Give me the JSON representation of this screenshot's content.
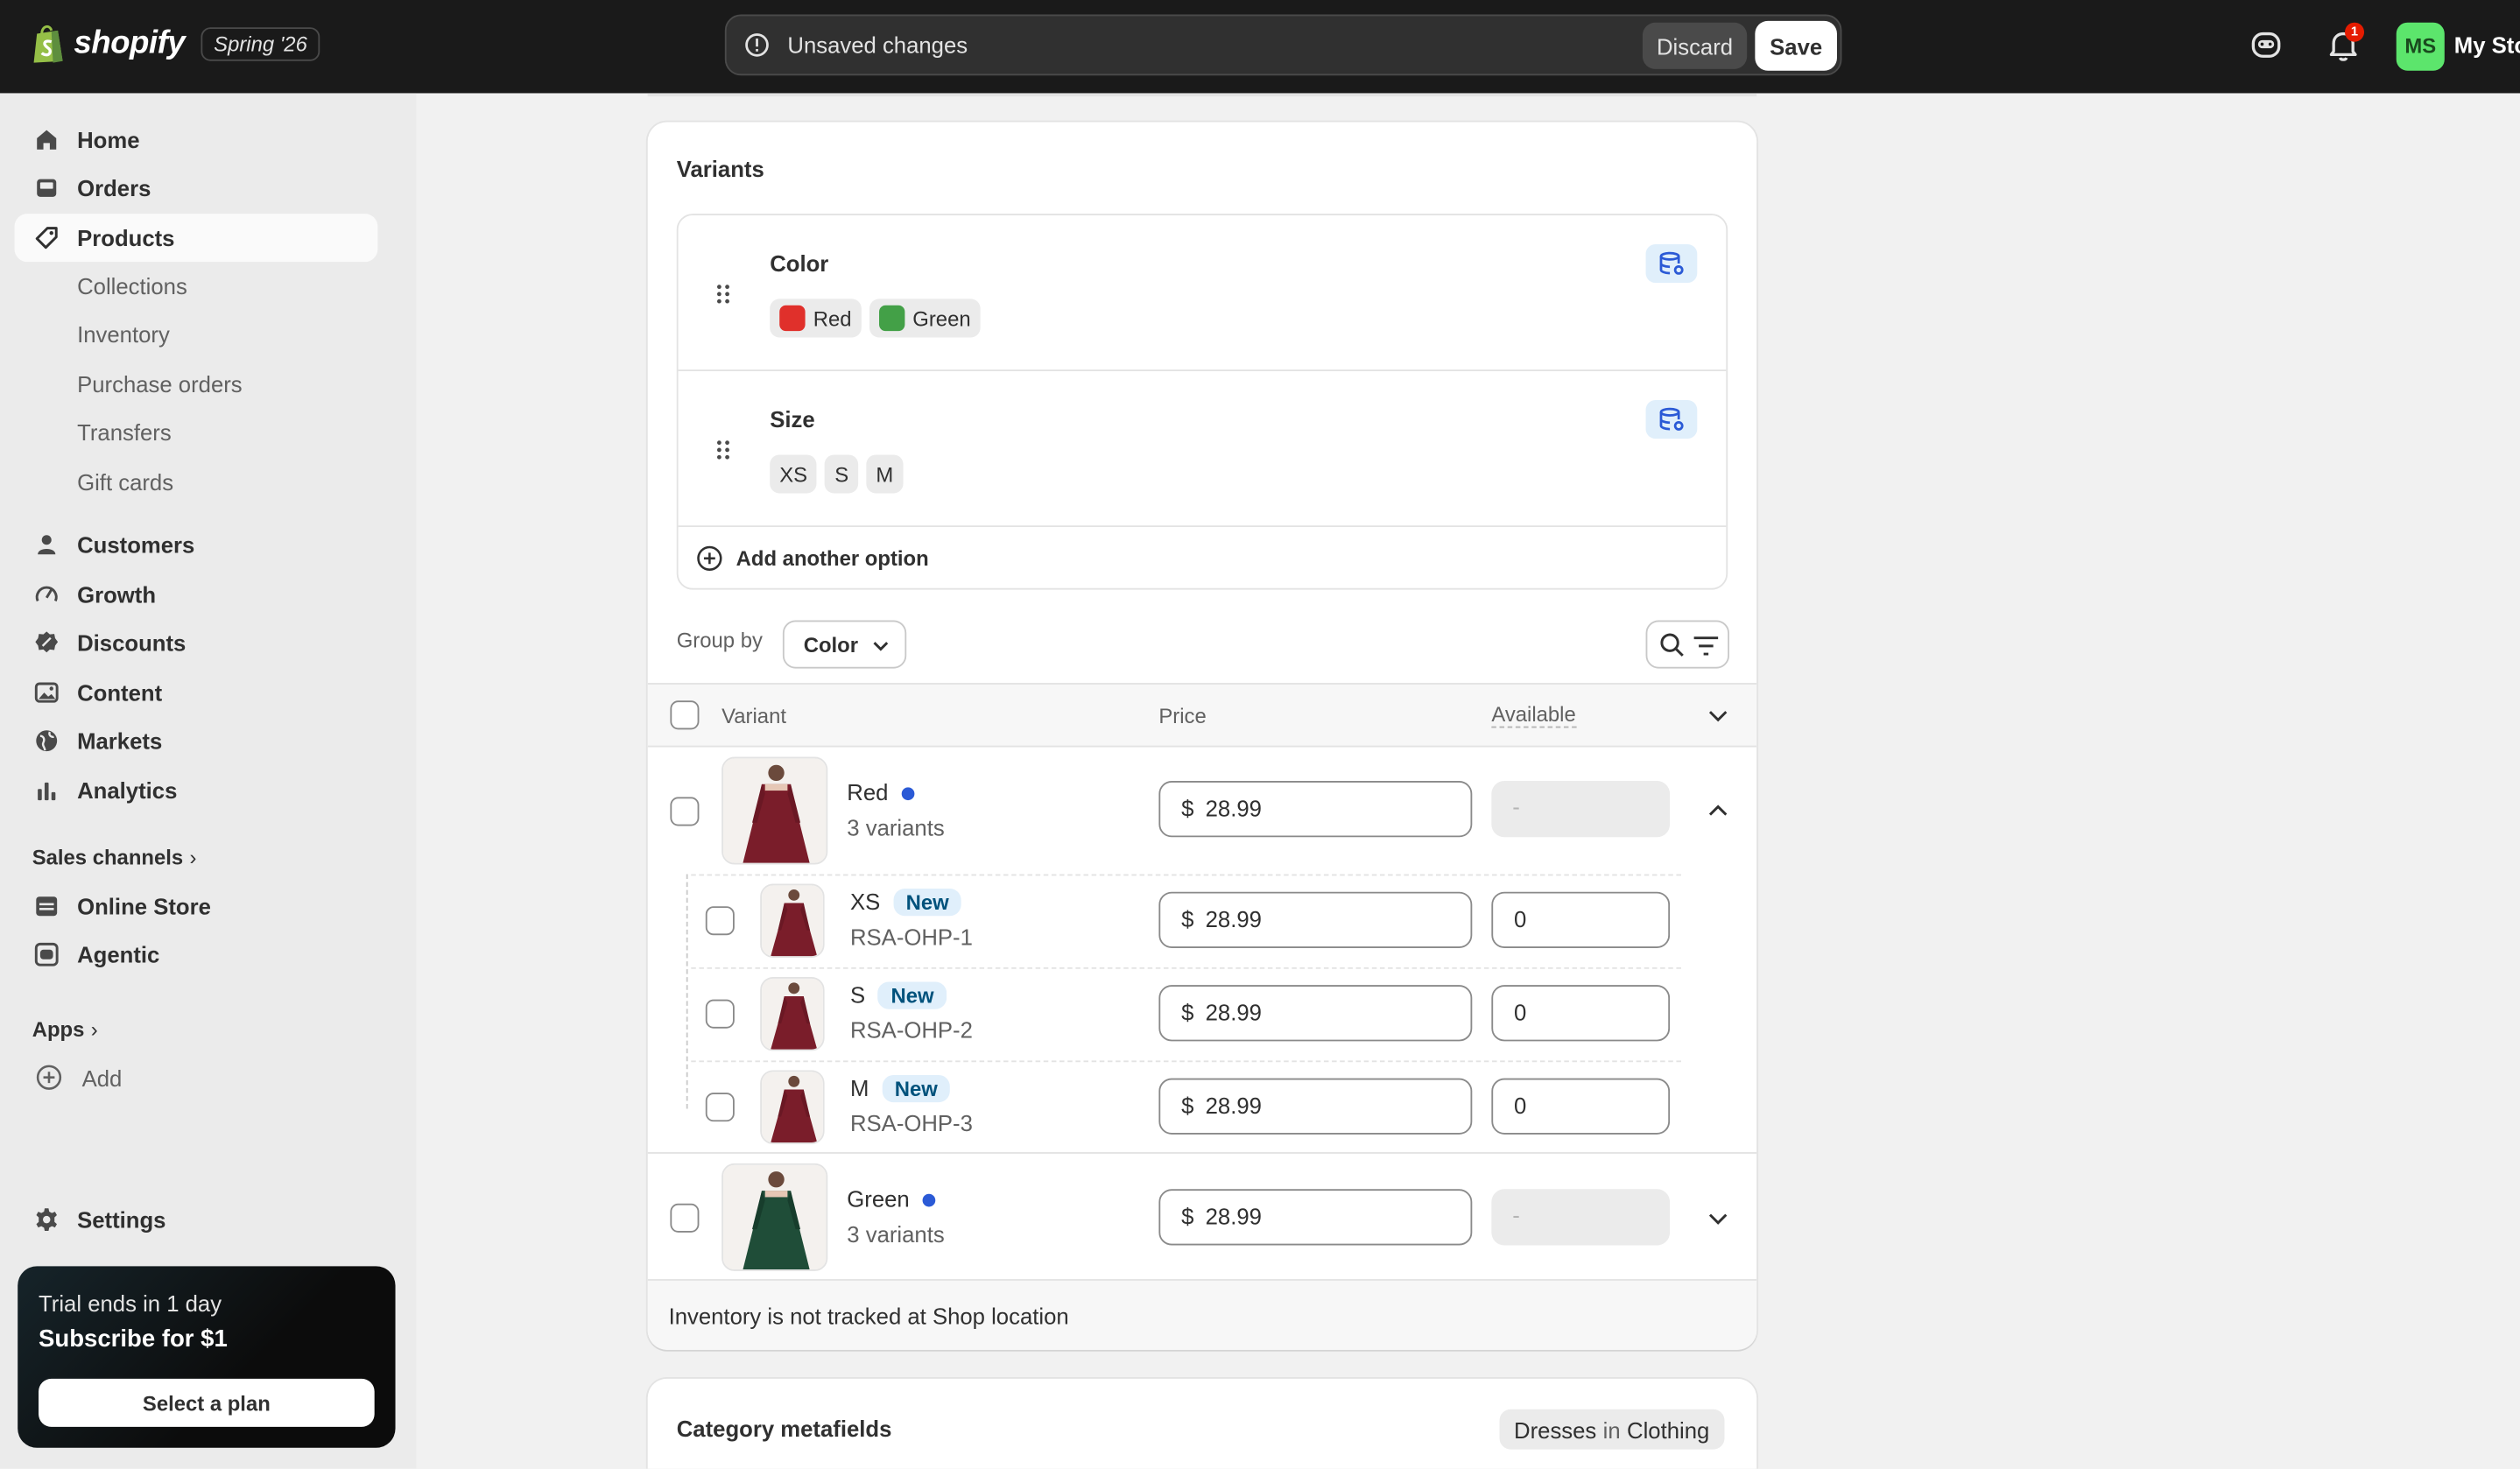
{
  "topbar": {
    "brand": "shopify",
    "edition": "Spring '26",
    "unsaved_message": "Unsaved changes",
    "discard_label": "Discard",
    "save_label": "Save",
    "notification_count": "1",
    "avatar_initials": "MS",
    "store_name": "My Sto"
  },
  "sidebar": {
    "items": [
      {
        "label": "Home",
        "icon": "home-icon"
      },
      {
        "label": "Orders",
        "icon": "inbox-icon"
      },
      {
        "label": "Products",
        "icon": "tag-icon"
      },
      {
        "label": "Customers",
        "icon": "person-icon"
      },
      {
        "label": "Growth",
        "icon": "gauge-icon"
      },
      {
        "label": "Discounts",
        "icon": "discount-icon"
      },
      {
        "label": "Content",
        "icon": "image-icon"
      },
      {
        "label": "Markets",
        "icon": "globe-icon"
      },
      {
        "label": "Analytics",
        "icon": "bar-chart-icon"
      }
    ],
    "product_subitems": [
      "Collections",
      "Inventory",
      "Purchase orders",
      "Transfers",
      "Gift cards"
    ],
    "sales_channels_label": "Sales channels",
    "channels": [
      {
        "label": "Online Store",
        "icon": "store-icon"
      },
      {
        "label": "Agentic",
        "icon": "robot-icon"
      }
    ],
    "apps_label": "Apps",
    "add_label": "Add",
    "settings_label": "Settings",
    "trial": {
      "line1": "Trial ends in 1 day",
      "line2": "Subscribe for $1",
      "button": "Select a plan"
    }
  },
  "variants_card": {
    "title": "Variants",
    "options": [
      {
        "name": "Color",
        "values": [
          {
            "label": "Red",
            "swatch": "#e0302b"
          },
          {
            "label": "Green",
            "swatch": "#43a047"
          }
        ]
      },
      {
        "name": "Size",
        "values": [
          {
            "label": "XS"
          },
          {
            "label": "S"
          },
          {
            "label": "M"
          }
        ]
      }
    ],
    "add_option_label": "Add another option",
    "group_by_label": "Group by",
    "group_by_value": "Color",
    "columns": {
      "variant": "Variant",
      "price": "Price",
      "available": "Available"
    },
    "groups": [
      {
        "name": "Red",
        "count": "3 variants",
        "price_currency": "$",
        "price": "28.99",
        "available": "-",
        "dress_color": "#7a1d2a",
        "children": [
          {
            "size": "XS",
            "badge": "New",
            "sku": "RSA-OHP-1",
            "price": "28.99",
            "available": "0"
          },
          {
            "size": "S",
            "badge": "New",
            "sku": "RSA-OHP-2",
            "price": "28.99",
            "available": "0"
          },
          {
            "size": "M",
            "badge": "New",
            "sku": "RSA-OHP-3",
            "price": "28.99",
            "available": "0"
          }
        ]
      },
      {
        "name": "Green",
        "count": "3 variants",
        "price_currency": "$",
        "price": "28.99",
        "available": "-",
        "dress_color": "#1f4d38"
      }
    ],
    "footer_note": "Inventory is not tracked at Shop location"
  },
  "category_card": {
    "title": "Category metafields",
    "category": "Dresses",
    "connector": "in",
    "parent": "Clothing"
  }
}
